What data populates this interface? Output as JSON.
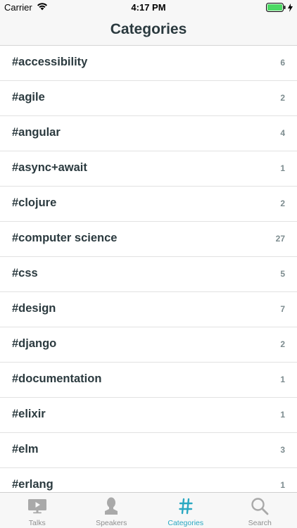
{
  "status_bar": {
    "carrier": "Carrier",
    "time": "4:17 PM",
    "battery_color": "#4cd964"
  },
  "nav": {
    "title": "Categories"
  },
  "categories": [
    {
      "label": "#accessibility",
      "count": "6"
    },
    {
      "label": "#agile",
      "count": "2"
    },
    {
      "label": "#angular",
      "count": "4"
    },
    {
      "label": "#async+await",
      "count": "1"
    },
    {
      "label": "#clojure",
      "count": "2"
    },
    {
      "label": "#computer science",
      "count": "27"
    },
    {
      "label": "#css",
      "count": "5"
    },
    {
      "label": "#design",
      "count": "7"
    },
    {
      "label": "#django",
      "count": "2"
    },
    {
      "label": "#documentation",
      "count": "1"
    },
    {
      "label": "#elixir",
      "count": "1"
    },
    {
      "label": "#elm",
      "count": "3"
    },
    {
      "label": "#erlang",
      "count": "1"
    }
  ],
  "tabs": [
    {
      "label": "Talks",
      "icon": "monitor-play-icon",
      "active": false
    },
    {
      "label": "Speakers",
      "icon": "person-icon",
      "active": false
    },
    {
      "label": "Categories",
      "icon": "hash-icon",
      "active": true
    },
    {
      "label": "Search",
      "icon": "magnifier-icon",
      "active": false
    }
  ],
  "colors": {
    "accent": "#2aa8c2",
    "text": "#2b3a3f",
    "muted": "#7d8c8f",
    "inactive_tab": "#a9a9a9"
  }
}
